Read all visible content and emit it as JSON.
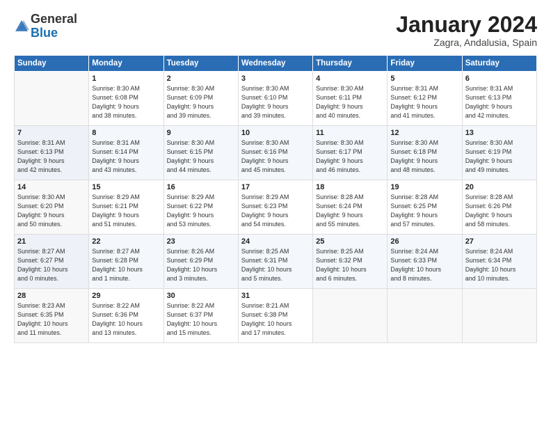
{
  "logo": {
    "general": "General",
    "blue": "Blue"
  },
  "header": {
    "month": "January 2024",
    "location": "Zagra, Andalusia, Spain"
  },
  "weekdays": [
    "Sunday",
    "Monday",
    "Tuesday",
    "Wednesday",
    "Thursday",
    "Friday",
    "Saturday"
  ],
  "weeks": [
    [
      {
        "day": "",
        "sunrise": "",
        "sunset": "",
        "daylight": ""
      },
      {
        "day": "1",
        "sunrise": "Sunrise: 8:30 AM",
        "sunset": "Sunset: 6:08 PM",
        "daylight": "Daylight: 9 hours and 38 minutes."
      },
      {
        "day": "2",
        "sunrise": "Sunrise: 8:30 AM",
        "sunset": "Sunset: 6:09 PM",
        "daylight": "Daylight: 9 hours and 39 minutes."
      },
      {
        "day": "3",
        "sunrise": "Sunrise: 8:30 AM",
        "sunset": "Sunset: 6:10 PM",
        "daylight": "Daylight: 9 hours and 39 minutes."
      },
      {
        "day": "4",
        "sunrise": "Sunrise: 8:30 AM",
        "sunset": "Sunset: 6:11 PM",
        "daylight": "Daylight: 9 hours and 40 minutes."
      },
      {
        "day": "5",
        "sunrise": "Sunrise: 8:31 AM",
        "sunset": "Sunset: 6:12 PM",
        "daylight": "Daylight: 9 hours and 41 minutes."
      },
      {
        "day": "6",
        "sunrise": "Sunrise: 8:31 AM",
        "sunset": "Sunset: 6:13 PM",
        "daylight": "Daylight: 9 hours and 42 minutes."
      }
    ],
    [
      {
        "day": "7",
        "sunrise": "Sunrise: 8:31 AM",
        "sunset": "Sunset: 6:13 PM",
        "daylight": "Daylight: 9 hours and 42 minutes."
      },
      {
        "day": "8",
        "sunrise": "Sunrise: 8:31 AM",
        "sunset": "Sunset: 6:14 PM",
        "daylight": "Daylight: 9 hours and 43 minutes."
      },
      {
        "day": "9",
        "sunrise": "Sunrise: 8:30 AM",
        "sunset": "Sunset: 6:15 PM",
        "daylight": "Daylight: 9 hours and 44 minutes."
      },
      {
        "day": "10",
        "sunrise": "Sunrise: 8:30 AM",
        "sunset": "Sunset: 6:16 PM",
        "daylight": "Daylight: 9 hours and 45 minutes."
      },
      {
        "day": "11",
        "sunrise": "Sunrise: 8:30 AM",
        "sunset": "Sunset: 6:17 PM",
        "daylight": "Daylight: 9 hours and 46 minutes."
      },
      {
        "day": "12",
        "sunrise": "Sunrise: 8:30 AM",
        "sunset": "Sunset: 6:18 PM",
        "daylight": "Daylight: 9 hours and 48 minutes."
      },
      {
        "day": "13",
        "sunrise": "Sunrise: 8:30 AM",
        "sunset": "Sunset: 6:19 PM",
        "daylight": "Daylight: 9 hours and 49 minutes."
      }
    ],
    [
      {
        "day": "14",
        "sunrise": "Sunrise: 8:30 AM",
        "sunset": "Sunset: 6:20 PM",
        "daylight": "Daylight: 9 hours and 50 minutes."
      },
      {
        "day": "15",
        "sunrise": "Sunrise: 8:29 AM",
        "sunset": "Sunset: 6:21 PM",
        "daylight": "Daylight: 9 hours and 51 minutes."
      },
      {
        "day": "16",
        "sunrise": "Sunrise: 8:29 AM",
        "sunset": "Sunset: 6:22 PM",
        "daylight": "Daylight: 9 hours and 53 minutes."
      },
      {
        "day": "17",
        "sunrise": "Sunrise: 8:29 AM",
        "sunset": "Sunset: 6:23 PM",
        "daylight": "Daylight: 9 hours and 54 minutes."
      },
      {
        "day": "18",
        "sunrise": "Sunrise: 8:28 AM",
        "sunset": "Sunset: 6:24 PM",
        "daylight": "Daylight: 9 hours and 55 minutes."
      },
      {
        "day": "19",
        "sunrise": "Sunrise: 8:28 AM",
        "sunset": "Sunset: 6:25 PM",
        "daylight": "Daylight: 9 hours and 57 minutes."
      },
      {
        "day": "20",
        "sunrise": "Sunrise: 8:28 AM",
        "sunset": "Sunset: 6:26 PM",
        "daylight": "Daylight: 9 hours and 58 minutes."
      }
    ],
    [
      {
        "day": "21",
        "sunrise": "Sunrise: 8:27 AM",
        "sunset": "Sunset: 6:27 PM",
        "daylight": "Daylight: 10 hours and 0 minutes."
      },
      {
        "day": "22",
        "sunrise": "Sunrise: 8:27 AM",
        "sunset": "Sunset: 6:28 PM",
        "daylight": "Daylight: 10 hours and 1 minute."
      },
      {
        "day": "23",
        "sunrise": "Sunrise: 8:26 AM",
        "sunset": "Sunset: 6:29 PM",
        "daylight": "Daylight: 10 hours and 3 minutes."
      },
      {
        "day": "24",
        "sunrise": "Sunrise: 8:25 AM",
        "sunset": "Sunset: 6:31 PM",
        "daylight": "Daylight: 10 hours and 5 minutes."
      },
      {
        "day": "25",
        "sunrise": "Sunrise: 8:25 AM",
        "sunset": "Sunset: 6:32 PM",
        "daylight": "Daylight: 10 hours and 6 minutes."
      },
      {
        "day": "26",
        "sunrise": "Sunrise: 8:24 AM",
        "sunset": "Sunset: 6:33 PM",
        "daylight": "Daylight: 10 hours and 8 minutes."
      },
      {
        "day": "27",
        "sunrise": "Sunrise: 8:24 AM",
        "sunset": "Sunset: 6:34 PM",
        "daylight": "Daylight: 10 hours and 10 minutes."
      }
    ],
    [
      {
        "day": "28",
        "sunrise": "Sunrise: 8:23 AM",
        "sunset": "Sunset: 6:35 PM",
        "daylight": "Daylight: 10 hours and 11 minutes."
      },
      {
        "day": "29",
        "sunrise": "Sunrise: 8:22 AM",
        "sunset": "Sunset: 6:36 PM",
        "daylight": "Daylight: 10 hours and 13 minutes."
      },
      {
        "day": "30",
        "sunrise": "Sunrise: 8:22 AM",
        "sunset": "Sunset: 6:37 PM",
        "daylight": "Daylight: 10 hours and 15 minutes."
      },
      {
        "day": "31",
        "sunrise": "Sunrise: 8:21 AM",
        "sunset": "Sunset: 6:38 PM",
        "daylight": "Daylight: 10 hours and 17 minutes."
      },
      {
        "day": "",
        "sunrise": "",
        "sunset": "",
        "daylight": ""
      },
      {
        "day": "",
        "sunrise": "",
        "sunset": "",
        "daylight": ""
      },
      {
        "day": "",
        "sunrise": "",
        "sunset": "",
        "daylight": ""
      }
    ]
  ]
}
